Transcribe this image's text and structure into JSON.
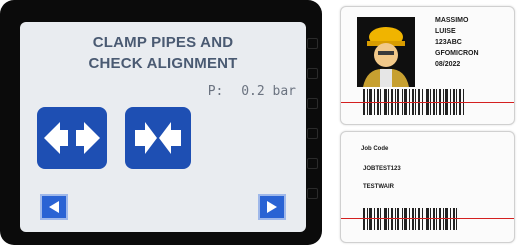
{
  "display": {
    "title_line1": "CLAMP PIPES AND",
    "title_line2": "CHECK ALIGNMENT",
    "pressure_label": "P:",
    "pressure_value": "0.2 bar",
    "buttons": {
      "open_clamps_icon": "arrows-apart-icon",
      "close_clamps_icon": "arrows-together-icon",
      "prev_icon": "triangle-left-icon",
      "next_icon": "triangle-right-icon"
    },
    "colors": {
      "screen_bg": "#e9ecf0",
      "title_text": "#4a5a72",
      "button_blue": "#1e4fb3"
    }
  },
  "operator_card": {
    "name_first": "MASSIMO",
    "name_last": "LUISE",
    "id": "123ABC",
    "company": "GFOMICRON",
    "date": "08/2022"
  },
  "job_card": {
    "label": "Job Code",
    "code": "JOBTEST123",
    "name": "TESTWAIR"
  }
}
